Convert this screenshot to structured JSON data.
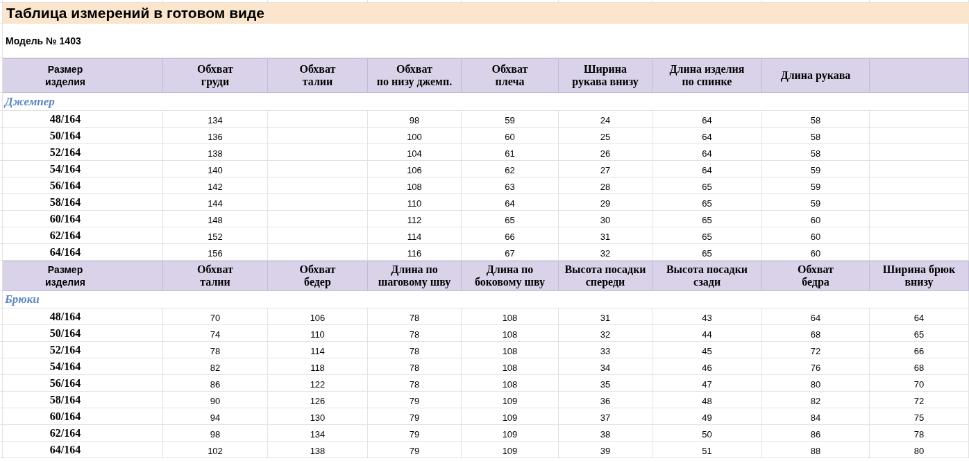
{
  "title": "Таблица измерений в готовом виде",
  "model": "Модель № 1403",
  "sections": [
    {
      "columns": [
        "Размер\nизделия",
        "Обхват\nгруди",
        "Обхват\nталии",
        "Обхват\nпо низу джемп.",
        "Обхват\nплеча",
        "Ширина\nрукава внизу",
        "Длина изделия\nпо спинке",
        "Длина рукава"
      ],
      "title": "Джемпер",
      "rows": [
        {
          "size": "48/164",
          "cells": {
            "column_2": "134",
            "column_4": "98",
            "column_5": "59",
            "column_6": "24",
            "column_7": "64",
            "column_8": "58"
          }
        },
        {
          "size": "50/164",
          "cells": {
            "column_2": "136",
            "column_4": "100",
            "column_5": "60",
            "column_6": "25",
            "column_7": "64",
            "column_8": "58"
          }
        },
        {
          "size": "52/164",
          "cells": {
            "column_2": "138",
            "column_4": "104",
            "column_5": "61",
            "column_6": "26",
            "column_7": "64",
            "column_8": "58"
          }
        },
        {
          "size": "54/164",
          "cells": {
            "column_2": "140",
            "column_4": "106",
            "column_5": "62",
            "column_6": "27",
            "column_7": "64",
            "column_8": "59"
          }
        },
        {
          "size": "56/164",
          "cells": {
            "column_2": "142",
            "column_4": "108",
            "column_5": "63",
            "column_6": "28",
            "column_7": "65",
            "column_8": "59"
          }
        },
        {
          "size": "58/164",
          "cells": {
            "column_2": "144",
            "column_4": "110",
            "column_5": "64",
            "column_6": "29",
            "column_7": "65",
            "column_8": "59"
          }
        },
        {
          "size": "60/164",
          "cells": {
            "column_2": "148",
            "column_4": "112",
            "column_5": "65",
            "column_6": "30",
            "column_7": "65",
            "column_8": "60"
          }
        },
        {
          "size": "62/164",
          "cells": {
            "column_2": "152",
            "column_4": "114",
            "column_5": "66",
            "column_6": "31",
            "column_7": "65",
            "column_8": "60"
          }
        },
        {
          "size": "64/164",
          "cells": {
            "column_2": "156",
            "column_4": "116",
            "column_5": "67",
            "column_6": "32",
            "column_7": "65",
            "column_8": "60"
          }
        }
      ]
    },
    {
      "columns": [
        "Размер\nизделия",
        "Обхват\nталии",
        "Обхват\nбедер",
        "Длина по\nшаговому шву",
        "Длина по\nбоковому шву",
        "Высота посадки\nспереди",
        "Высота посадки\nсзади",
        "Обхват\nбедра",
        "Ширина брюк\nвнизу"
      ],
      "title": "Брюки",
      "rows": [
        {
          "size": "48/164",
          "cells": {
            "column_2": "70",
            "column_3": "106",
            "column_4": "78",
            "column_5": "108",
            "column_6": "31",
            "column_7": "43",
            "column_8": "64",
            "column_9": "64"
          }
        },
        {
          "size": "50/164",
          "cells": {
            "column_2": "74",
            "column_3": "110",
            "column_4": "78",
            "column_5": "108",
            "column_6": "32",
            "column_7": "44",
            "column_8": "68",
            "column_9": "65"
          }
        },
        {
          "size": "52/164",
          "cells": {
            "column_2": "78",
            "column_3": "114",
            "column_4": "78",
            "column_5": "108",
            "column_6": "33",
            "column_7": "45",
            "column_8": "72",
            "column_9": "66"
          }
        },
        {
          "size": "54/164",
          "cells": {
            "column_2": "82",
            "column_3": "118",
            "column_4": "78",
            "column_5": "108",
            "column_6": "34",
            "column_7": "46",
            "column_8": "76",
            "column_9": "68"
          }
        },
        {
          "size": "56/164",
          "cells": {
            "column_2": "86",
            "column_3": "122",
            "column_4": "78",
            "column_5": "108",
            "column_6": "35",
            "column_7": "47",
            "column_8": "80",
            "column_9": "70"
          }
        },
        {
          "size": "58/164",
          "cells": {
            "column_2": "90",
            "column_3": "126",
            "column_4": "79",
            "column_5": "109",
            "column_6": "36",
            "column_7": "48",
            "column_8": "82",
            "column_9": "72"
          }
        },
        {
          "size": "60/164",
          "cells": {
            "column_2": "94",
            "column_3": "130",
            "column_4": "79",
            "column_5": "109",
            "column_6": "37",
            "column_7": "49",
            "column_8": "84",
            "column_9": "75"
          }
        },
        {
          "size": "62/164",
          "cells": {
            "column_2": "98",
            "column_3": "134",
            "column_4": "79",
            "column_5": "109",
            "column_6": "38",
            "column_7": "50",
            "column_8": "86",
            "column_9": "78"
          }
        },
        {
          "size": "64/164",
          "cells": {
            "column_2": "102",
            "column_3": "138",
            "column_4": "79",
            "column_5": "109",
            "column_6": "39",
            "column_7": "51",
            "column_8": "88",
            "column_9": "80"
          }
        }
      ]
    }
  ]
}
